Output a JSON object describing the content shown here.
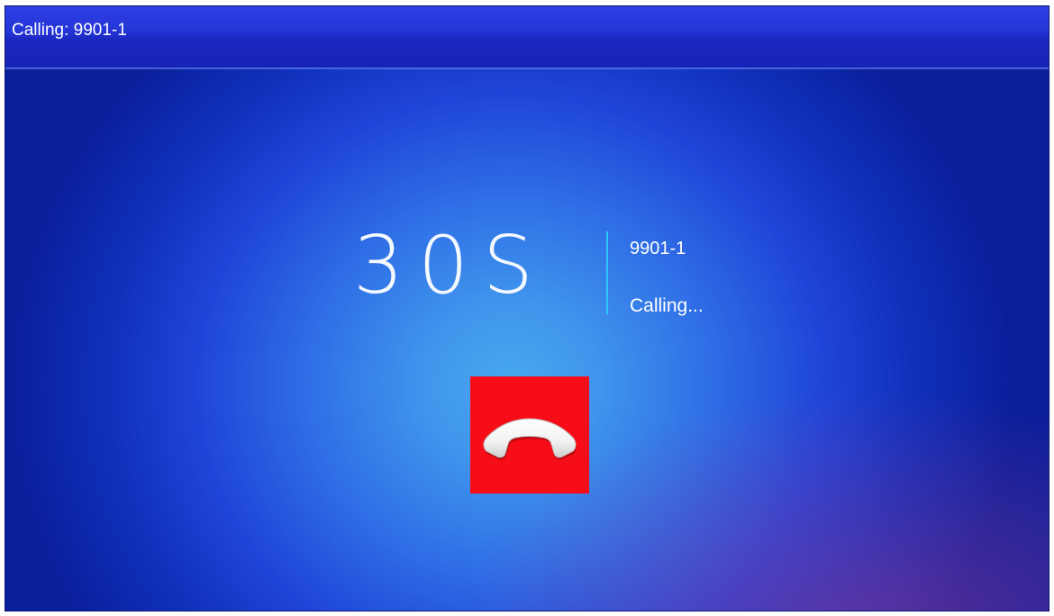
{
  "window": {
    "title": "Calling: 9901-1"
  },
  "call": {
    "timer": "30S",
    "number": "9901-1",
    "status": "Calling..."
  },
  "hangup_button": {
    "icon": "phone-hangup-icon",
    "color": "#f70d17"
  },
  "colors": {
    "titlebar": "#2536d8",
    "background_center": "#48a8ee",
    "background_edge": "#0a1e9a",
    "divider": "#2ec6ff"
  }
}
